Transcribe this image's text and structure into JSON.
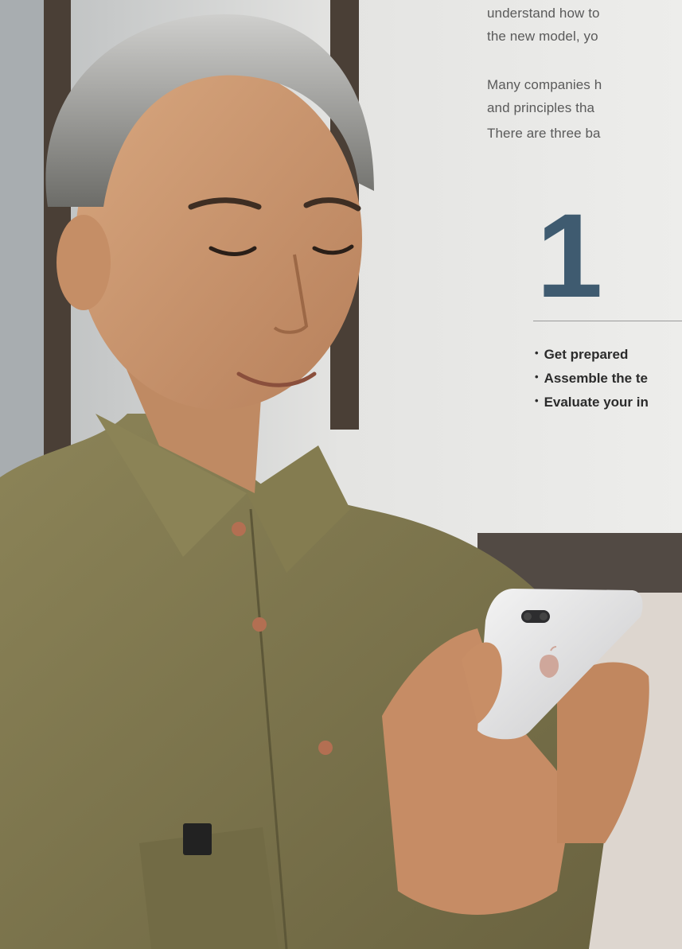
{
  "article": {
    "paragraphs": [
      {
        "lines": [
          "understand how to",
          "the new model, yo"
        ]
      },
      {
        "lines": [
          "Many companies h",
          "and principles tha"
        ]
      },
      {
        "lines": [
          "There are three ba"
        ]
      }
    ],
    "step_number": "1",
    "bullets": [
      "Get prepared",
      "Assemble the te",
      "Evaluate your in"
    ]
  },
  "photo": {
    "subject": "man looking at smartphone",
    "icons": [
      "phone-icon",
      "apple-logo-icon"
    ]
  },
  "colors": {
    "step_number": "#3f5b70",
    "body_text": "#5a5a5a",
    "bullet_text": "#2b2b2b",
    "shirt": "#7e7650"
  }
}
